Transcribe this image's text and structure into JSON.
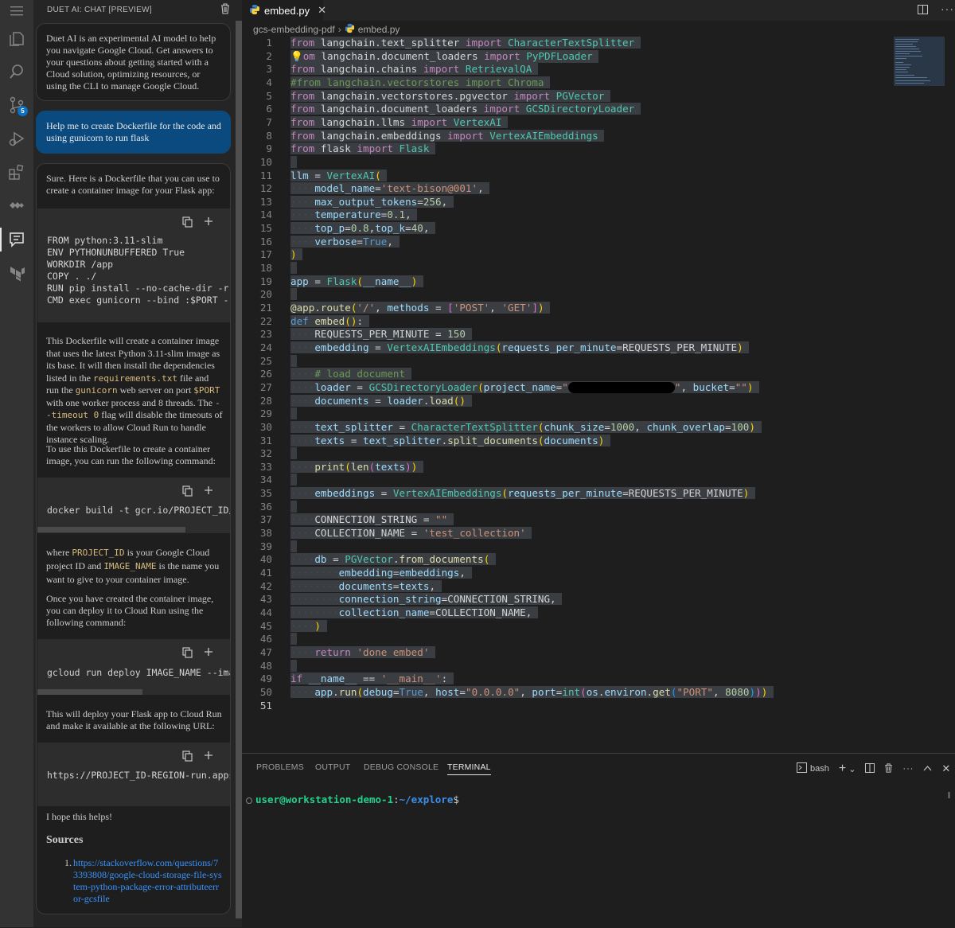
{
  "sidebar": {
    "title": "DUET AI: CHAT [PREVIEW]",
    "intro": "Duet AI is an experimental AI model to help you navigate Google Cloud. Get answers to your questions about getting started with a Cloud solution, optimizing resources, or using the CLI to manage Google Cloud.",
    "user_message": "Help me to create Dockerfile for the code and using gunicorn to run flask",
    "response_intro": "Sure. Here is a Dockerfile that you can use to create a container image for your Flask app:",
    "dockerfile": "FROM python:3.11-slim\nENV PYTHONUNBUFFERED True\nWORKDIR /app\nCOPY . ./\nRUN pip install --no-cache-dir -r r\nCMD exec gunicorn --bind :$PORT --w",
    "explain_1a": "This Dockerfile will create a container image that uses the latest Python 3.11-slim image as its base. It will then install the dependencies listed in the ",
    "explain_code_req": "requirements.txt",
    "explain_1b": " file and run the ",
    "explain_code_gunicorn": "gunicorn",
    "explain_1c": " web server on port ",
    "explain_code_port": "$PORT",
    "explain_1d": " with one worker process and 8 threads. The ",
    "explain_code_timeout": "--timeout 0",
    "explain_1e": " flag will disable the timeouts of the workers to allow Cloud Run to handle instance scaling.",
    "explain_2": "To use this Dockerfile to create a container image, you can run the following command:",
    "docker_cmd": "docker build -t gcr.io/PROJECT_ID/I",
    "where_a": "where ",
    "where_code_project": "PROJECT_ID",
    "where_b": " is your Google Cloud project ID and ",
    "where_code_image": "IMAGE_NAME",
    "where_c": " is the name you want to give to your container image.",
    "deploy_text": "Once you have created the container image, you can deploy it to Cloud Run using the following command:",
    "gcloud_cmd": "gcloud run deploy IMAGE_NAME --imag",
    "url_text": "This will deploy your Flask app to Cloud Run and make it available at the following URL:",
    "url_code": "https://PROJECT_ID-REGION-run.appsp",
    "closing": "I hope this helps!",
    "sources_title": "Sources",
    "source_index": "1.",
    "source_link": "https://stackoverflow.com/questions/73393808/google-cloud-storage-file-system-python-package-error-attributeerror-gcsfile"
  },
  "activity_bar": {
    "icons": [
      "menu-icon",
      "explorer-icon",
      "search-icon",
      "source-control-icon",
      "run-debug-icon",
      "extensions-icon",
      "cloud-code-icon",
      "duet-chat-icon",
      "terraform-icon"
    ],
    "source_control_badge": "5"
  },
  "editor": {
    "tab_label": "embed.py",
    "breadcrumb_folder": "gcs-embedding-pdf",
    "breadcrumb_file": "embed.py",
    "current_line": 51
  },
  "panel": {
    "tabs": [
      "PROBLEMS",
      "OUTPUT",
      "DEBUG CONSOLE",
      "TERMINAL"
    ],
    "active_tab": "TERMINAL",
    "shell_label": "bash",
    "prompt_user": "user@workstation-demo-1",
    "prompt_sep": ":",
    "prompt_path": "~/explore",
    "prompt_symbol": "$"
  },
  "colors": {
    "accent": "#0e70c0",
    "user_bubble": "#0b4a7e",
    "link": "#3794ff",
    "terminal_user": "#23d18b",
    "terminal_path": "#3b8eea"
  }
}
